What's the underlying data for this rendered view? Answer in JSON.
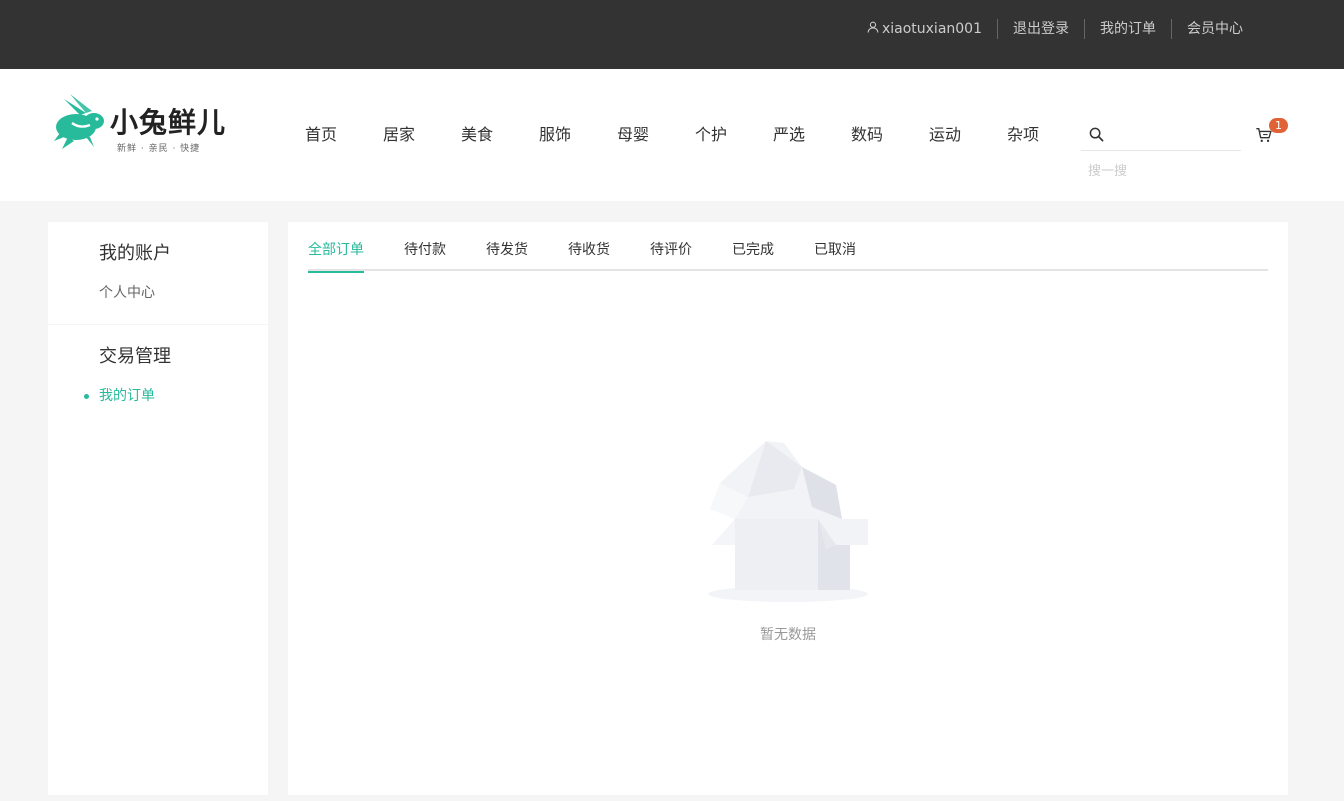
{
  "topbar": {
    "username": "xiaotuxian001",
    "logout": "退出登录",
    "my_orders": "我的订单",
    "member_center": "会员中心"
  },
  "brand": {
    "name": "小兔鲜儿",
    "slogan": "新鲜 · 亲民 · 快捷",
    "accent_color": "#27ba9b"
  },
  "nav": {
    "items": [
      "首页",
      "居家",
      "美食",
      "服饰",
      "母婴",
      "个护",
      "严选",
      "数码",
      "运动",
      "杂项"
    ]
  },
  "search": {
    "hint": "搜一搜",
    "value": ""
  },
  "cart": {
    "count": "1",
    "badge_color": "#e26237"
  },
  "sidebar": {
    "groups": [
      {
        "title": "我的账户",
        "items": [
          {
            "label": "个人中心"
          }
        ]
      },
      {
        "title": "交易管理",
        "items": [
          {
            "label": "我的订单"
          }
        ]
      }
    ]
  },
  "orders": {
    "tabs": [
      "全部订单",
      "待付款",
      "待发货",
      "待收货",
      "待评价",
      "已完成",
      "已取消"
    ],
    "active_tab": "全部订单",
    "empty_text": "暂无数据"
  }
}
